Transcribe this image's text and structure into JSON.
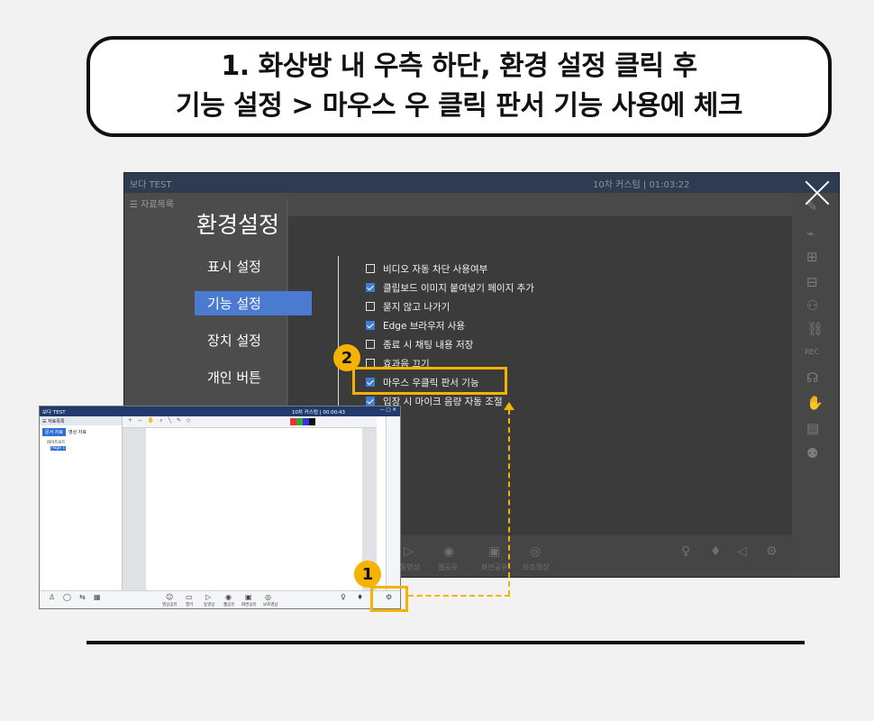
{
  "title": {
    "line1": "1. 화상방 내 우측 하단, 환경 설정 클릭 후",
    "line2": "기능 설정 > 마우스 우 클릭 판서 기능 사용에 체크"
  },
  "big_window": {
    "app_logo": "보다 TEST",
    "top_center": "10차 커스텀 | 01:03:22",
    "sidebar_header": "☰ 자료목록",
    "settings_title": "환경설정",
    "menu": [
      {
        "label": "표시 설정",
        "active": false
      },
      {
        "label": "기능 설정",
        "active": true
      },
      {
        "label": "장치 설정",
        "active": false
      },
      {
        "label": "개인 버튼",
        "active": false
      }
    ],
    "options": [
      {
        "label": "비디오 자동 차단 사용여부",
        "checked": false
      },
      {
        "label": "클립보드 이미지 붙여넣기 페이지 추가",
        "checked": true
      },
      {
        "label": "묻지 않고 나가기",
        "checked": false
      },
      {
        "label": "Edge 브라우저 사용",
        "checked": true
      },
      {
        "label": "종료 시 채팅 내용 저장",
        "checked": false
      },
      {
        "label": "효과음 끄기",
        "checked": false
      },
      {
        "label": "마우스 우클릭 판서 기능",
        "checked": true
      },
      {
        "label": "입장 시 마이크 음량 자동 조절",
        "checked": true
      }
    ],
    "bottom_labels": [
      "열기",
      "동영상",
      "웹공유",
      "화면공유",
      "보조영상"
    ],
    "right_rec": "REC"
  },
  "small_window": {
    "app_logo": "보다 TEST",
    "top_right": "10차 커스텀 | 00:00:43",
    "sidebar_header": "☰ 자료목록",
    "tabs": [
      "문서 자료",
      "영상 자료"
    ],
    "tree_item": "화이트보드",
    "tree_sub": "Page 1",
    "bottom_labels": [
      "영상공유",
      "열기",
      "동영상",
      "웹공유",
      "화면공유",
      "보조영상"
    ]
  },
  "badges": {
    "one": "1",
    "two": "2"
  },
  "accent_color": "#f5b301"
}
